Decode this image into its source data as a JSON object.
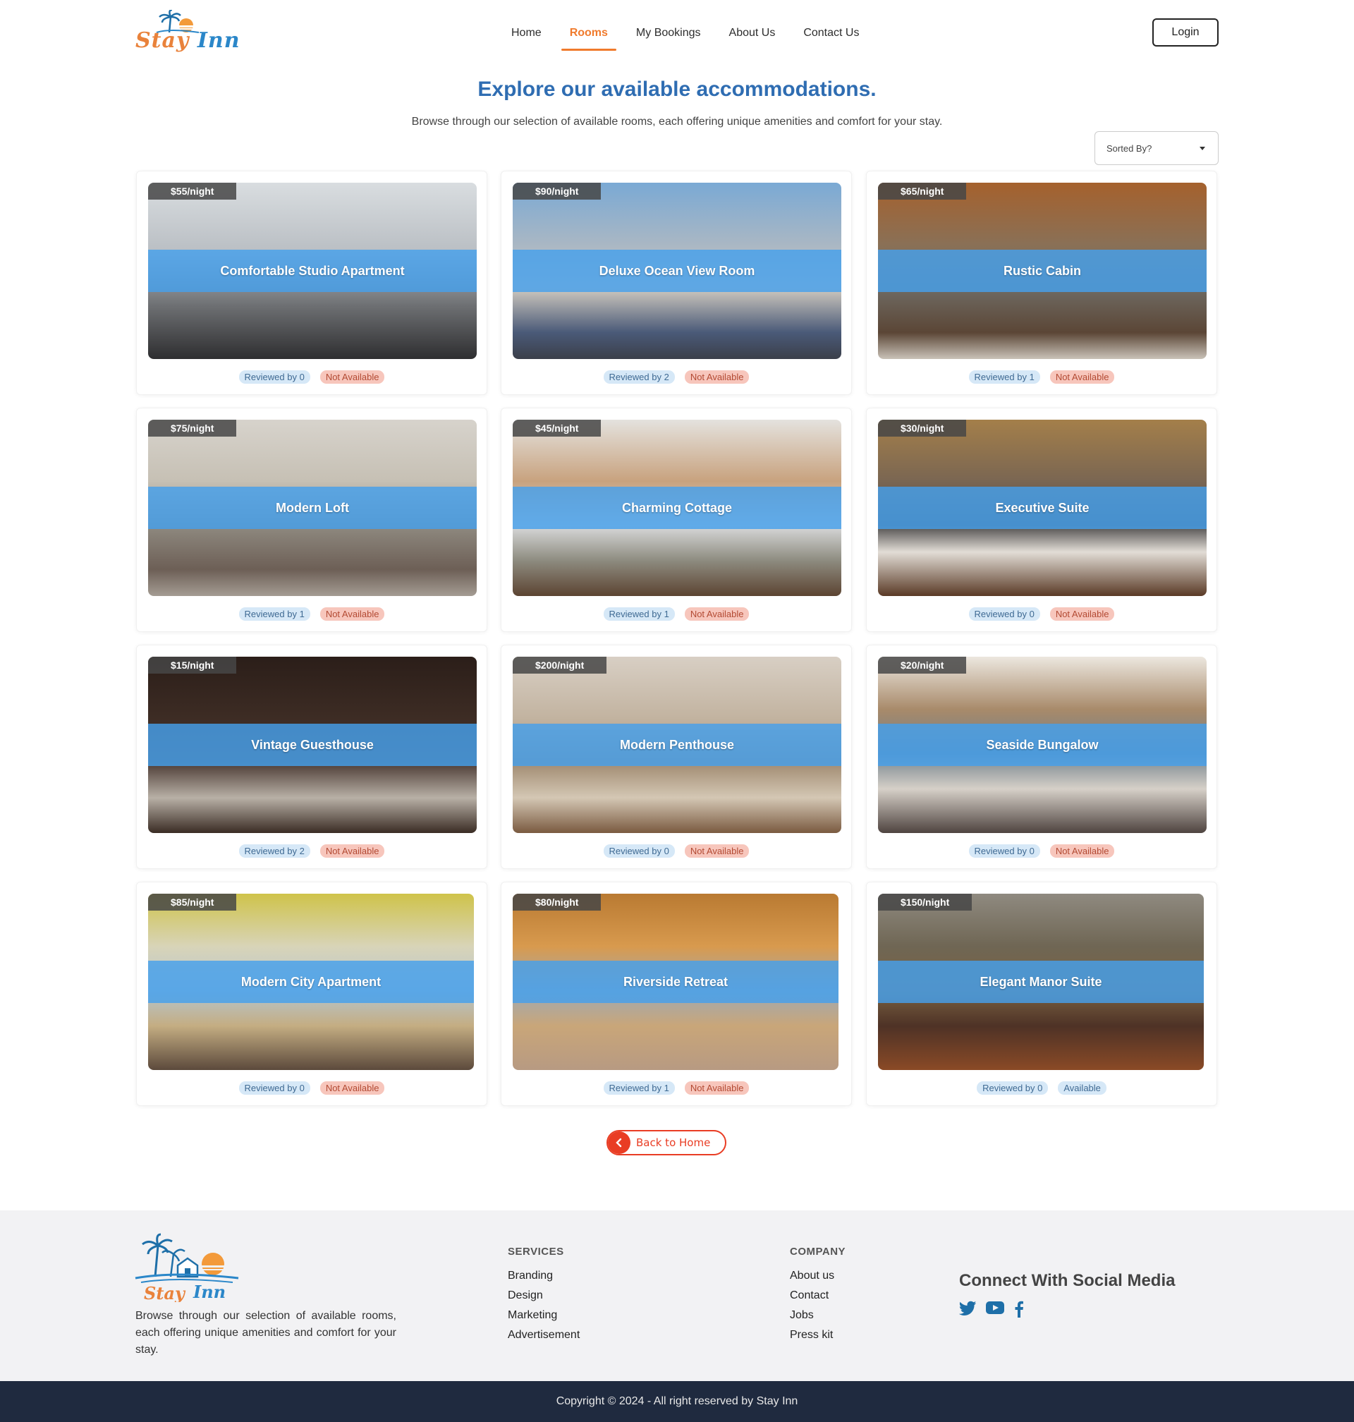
{
  "brand": {
    "name_part1": "Stay",
    "name_part2": "Inn"
  },
  "nav": {
    "items": [
      {
        "label": "Home",
        "active": false
      },
      {
        "label": "Rooms",
        "active": true
      },
      {
        "label": "My Bookings",
        "active": false
      },
      {
        "label": "About Us",
        "active": false
      },
      {
        "label": "Contact Us",
        "active": false
      }
    ],
    "login_label": "Login",
    "accent_color": "#f07a2c"
  },
  "hero": {
    "title": "Explore our available accommodations.",
    "subtitle": "Browse through our selection of available rooms, each offering unique amenities and comfort for your stay.",
    "sort_label": "Sorted By?"
  },
  "rooms": [
    {
      "name": "Comfortable Studio Apartment",
      "price": "$55/night",
      "reviews": "Reviewed by 0",
      "status": "Not Available"
    },
    {
      "name": "Deluxe Ocean View Room",
      "price": "$90/night",
      "reviews": "Reviewed by 2",
      "status": "Not Available"
    },
    {
      "name": "Rustic Cabin",
      "price": "$65/night",
      "reviews": "Reviewed by 1",
      "status": "Not Available"
    },
    {
      "name": "Modern Loft",
      "price": "$75/night",
      "reviews": "Reviewed by 1",
      "status": "Not Available"
    },
    {
      "name": "Charming Cottage",
      "price": "$45/night",
      "reviews": "Reviewed by 1",
      "status": "Not Available"
    },
    {
      "name": "Executive Suite",
      "price": "$30/night",
      "reviews": "Reviewed by 0",
      "status": "Not Available"
    },
    {
      "name": "Vintage Guesthouse",
      "price": "$15/night",
      "reviews": "Reviewed by 2",
      "status": "Not Available"
    },
    {
      "name": "Modern Penthouse",
      "price": "$200/night",
      "reviews": "Reviewed by 0",
      "status": "Not Available"
    },
    {
      "name": "Seaside Bungalow",
      "price": "$20/night",
      "reviews": "Reviewed by 0",
      "status": "Not Available"
    },
    {
      "name": "Modern City Apartment",
      "price": "$85/night",
      "reviews": "Reviewed by 0",
      "status": "Not Available"
    },
    {
      "name": "Riverside Retreat",
      "price": "$80/night",
      "reviews": "Reviewed by 1",
      "status": "Not Available"
    },
    {
      "name": "Elegant Manor Suite",
      "price": "$150/night",
      "reviews": "Reviewed by 0",
      "status": "Available"
    }
  ],
  "back_button": {
    "label": "Back to Home"
  },
  "footer": {
    "about": "Browse through our selection of available rooms, each offering unique amenities and comfort for your stay.",
    "services": {
      "heading": "SERVICES",
      "links": [
        "Branding",
        "Design",
        "Marketing",
        "Advertisement"
      ]
    },
    "company": {
      "heading": "COMPANY",
      "links": [
        "About us",
        "Contact",
        "Jobs",
        "Press kit"
      ]
    },
    "social": {
      "heading": "Connect With Social Media",
      "icons": [
        "twitter-icon",
        "youtube-icon",
        "facebook-icon"
      ]
    },
    "copyright": "Copyright © 2024 - All right reserved by Stay Inn"
  },
  "colors": {
    "title_blue": "#2f6db2",
    "band_blue": "#46a0eb",
    "not_available": "#b34a33",
    "available": "#3f6a93",
    "back_red": "#e93d24",
    "footer_dark": "#1f2a3f"
  }
}
